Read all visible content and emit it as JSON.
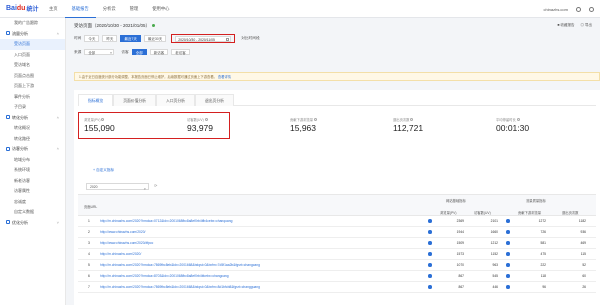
{
  "brand": {
    "bai": "Bai",
    "du": "du",
    "tj": "统计"
  },
  "topnav": [
    "主页",
    "基础报告",
    "分析云",
    "管理",
    "使用中心"
  ],
  "topnav_active": 1,
  "topright": {
    "site": "chinazhs.com",
    "tools": [
      "▢",
      "◯"
    ]
  },
  "sidebar": [
    {
      "label": "我的广告跟踪",
      "type": "item"
    },
    {
      "label": "流量分析",
      "type": "group"
    },
    {
      "label": "受访页面",
      "type": "item",
      "active": true
    },
    {
      "label": "入口页面",
      "type": "item"
    },
    {
      "label": "受访域名",
      "type": "item"
    },
    {
      "label": "页面点击图",
      "type": "item"
    },
    {
      "label": "页面上下游",
      "type": "item"
    },
    {
      "label": "事件分析",
      "type": "item"
    },
    {
      "label": "子目录",
      "type": "item"
    },
    {
      "label": "转化分析",
      "type": "group"
    },
    {
      "label": "转化概况",
      "type": "item"
    },
    {
      "label": "转化路径",
      "type": "item"
    },
    {
      "label": "访客分析",
      "type": "group"
    },
    {
      "label": "地域分布",
      "type": "item"
    },
    {
      "label": "系统环境",
      "type": "item"
    },
    {
      "label": "新老访客",
      "type": "item"
    },
    {
      "label": "访客属性",
      "type": "item"
    },
    {
      "label": "忠诚度",
      "type": "item"
    },
    {
      "label": "自定义数据",
      "type": "item"
    },
    {
      "label": "优化分析",
      "type": "group"
    }
  ],
  "header": {
    "title": "受访页面（2020/10/30 - 2021/01/05）",
    "actions": [
      "■ 收藏报告",
      "◎ 导出"
    ]
  },
  "filters": {
    "time_label": "时间",
    "chips": [
      "今天",
      "昨天",
      "最近7天",
      "最近30天"
    ],
    "chips_active": 2,
    "date_range": "2020/10/30 - 2020/11/05",
    "compare": "对比时间段",
    "source_label": "来源",
    "source_value": "全部",
    "visitor_label": "访客",
    "visitor_chips": [
      "全部",
      "新访客",
      "老访客"
    ],
    "visitor_active": 0
  },
  "notice": {
    "text": "1.由于近日百度统计部分功能调整，本报告页面已停止维护，后续数据可通过页面上下游查看。",
    "link": "查看详情"
  },
  "tabs": [
    "指标概览",
    "页面价值分析",
    "入口页分析",
    "退出页分析"
  ],
  "tabs_active": 0,
  "kpis": [
    {
      "label": "浏览量(PV)",
      "value": "155,090"
    },
    {
      "label": "访客数(UV)",
      "value": "93,979"
    },
    {
      "label": "贡献下游浏览量",
      "value": "15,963"
    },
    {
      "label": "退出页次数",
      "value": "112,721"
    },
    {
      "label": "平均停留时长",
      "value": "00:01:30"
    }
  ],
  "add_button": "+ 自定义指标",
  "search": {
    "value": "2020",
    "clear": "⟳"
  },
  "table": {
    "col_url": "页面URL",
    "group1": "网站基础指标",
    "group2": "流量质量指标",
    "sub_cols": [
      "浏览量(PV)",
      "访客数(UV)",
      "贡献下游浏览量",
      "退出页次数"
    ],
    "rows": [
      {
        "n": "1",
        "url": "http://m.chinazhs.com/2020?hmdca=0712&ldx=2001068fbc8a8ef0rb4tfb4cebx=chanquang",
        "pv": "2369",
        "uv": "2101",
        "down": "1272",
        "exit": "1182"
      },
      {
        "n": "2",
        "url": "http://www.chinazhs.com/2020/",
        "pv": "1944",
        "uv": "1660",
        "down": "726",
        "exit": "936"
      },
      {
        "n": "3",
        "url": "http://www.chinazhs.com/2020/#fpcc",
        "pv": "1509",
        "uv": "1212",
        "down": "581",
        "exit": "469"
      },
      {
        "n": "4",
        "url": "http://m.chinazhs.com/2020/",
        "pv": "1573",
        "uv": "1152",
        "down": "475",
        "exit": "115"
      },
      {
        "n": "5",
        "url": "http://m.chinazhs.com/2020?hmdca=7869fbc8eb&ldx=2001668&bdqst=0&bxfm=7d5f1aa2b&fgsrt=changcang",
        "pv": "1070",
        "uv": "963",
        "down": "222",
        "exit": "52"
      },
      {
        "n": "6",
        "url": "http://m.chinazhs.com/2020?hmdca=8703&ldx=2001068fbc8a8ef0rb4tfcebx=changcang",
        "pv": "867",
        "uv": "545",
        "down": "118",
        "exit": "60"
      },
      {
        "n": "7",
        "url": "http://m.chinazhs.com/2020?hmdca=7869fbc8eb&ldx=2001668&bdqst=0&bxfm=8d1bfcb8&fgsrt=changguang",
        "pv": "867",
        "uv": "446",
        "down": "96",
        "exit": "26"
      }
    ]
  }
}
